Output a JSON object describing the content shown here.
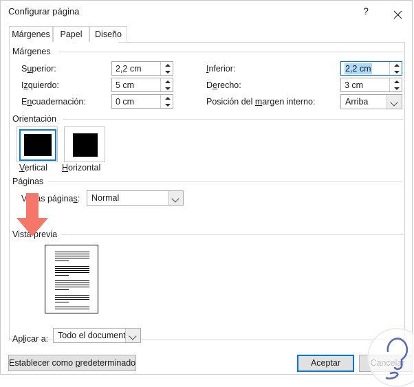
{
  "window": {
    "title": "Configurar página",
    "help_label": "?",
    "close_label": "Cerrar"
  },
  "tabs": [
    {
      "label": "Márgenes",
      "active": true
    },
    {
      "label": "Papel",
      "active": false
    },
    {
      "label": "Diseño",
      "active": false
    }
  ],
  "groups": {
    "margins": "Márgenes",
    "orientation": "Orientación",
    "pages": "Páginas",
    "preview": "Vista previa"
  },
  "margins": {
    "superior": {
      "label": "Superior:",
      "value": "2,2 cm"
    },
    "izquierdo": {
      "label": "Izquierdo:",
      "value": "5 cm"
    },
    "encuadernacion": {
      "label": "Encuadernación:",
      "value": "0 cm"
    },
    "inferior": {
      "label": "Inferior:",
      "value": "2,2 cm",
      "selected": true,
      "focused": true
    },
    "derecho": {
      "label": "Derecho:",
      "value": "3 cm"
    },
    "posicion_margen": {
      "label": "Posición del margen interno:",
      "value": "Arriba"
    }
  },
  "orientation": {
    "vertical": {
      "label": "Vertical",
      "selected": true
    },
    "horizontal": {
      "label": "Horizontal",
      "selected": false
    }
  },
  "pages": {
    "varias_paginas": {
      "label": "Varias páginas:",
      "value": "Normal"
    }
  },
  "apply": {
    "label": "Aplicar a:",
    "value": "Todo el documento"
  },
  "footer": {
    "set_default": "Establecer como predeterminado",
    "accept": "Aceptar",
    "cancel": "Cancelar"
  },
  "annotation": {
    "arrow_color": "#f4776a"
  },
  "colors": {
    "accent": "#0078d7",
    "selection": "#addaf7",
    "dialog_bg": "#ffffff",
    "button_bg": "#e1e1e1"
  }
}
